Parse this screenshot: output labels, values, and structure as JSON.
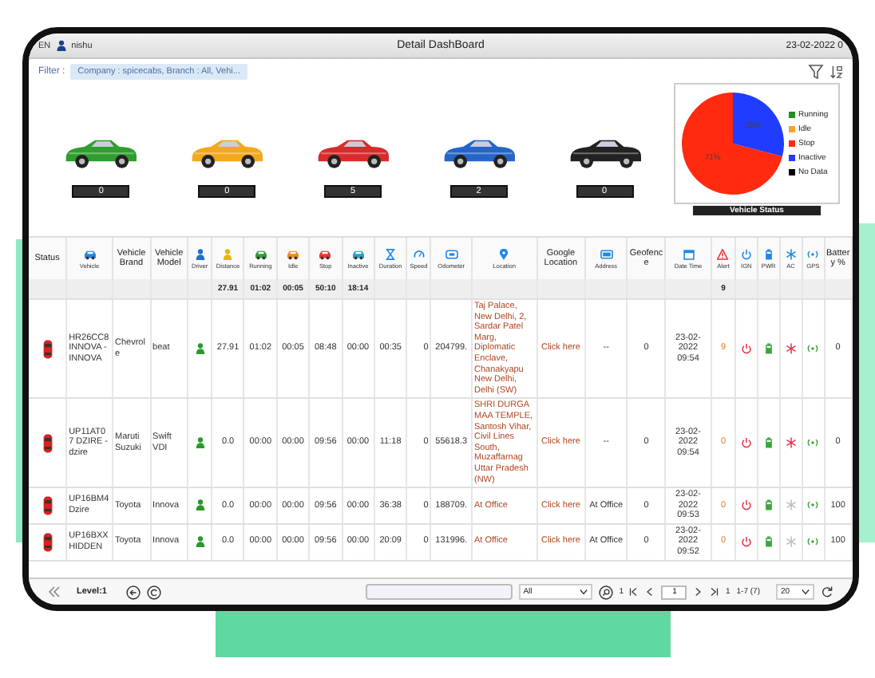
{
  "topbar": {
    "language": "EN",
    "user": "nishu",
    "title": "Detail DashBoard",
    "date": "23-02-2022 0"
  },
  "filter": {
    "label": "Filter :",
    "value": "Company : spicecabs, Branch : All, Vehi..."
  },
  "status_cards": [
    {
      "count": "0",
      "color": "#2f9e2f"
    },
    {
      "count": "0",
      "color": "#f2a81d"
    },
    {
      "count": "5",
      "color": "#d92b2b"
    },
    {
      "count": "2",
      "color": "#2565c8"
    },
    {
      "count": "0",
      "color": "#222222"
    }
  ],
  "status_chart": {
    "title": "Vehicle Status",
    "legend": [
      {
        "color": "#1f8f1f"
      },
      {
        "color": "#f5a623"
      },
      {
        "color": "#ff2a10"
      },
      {
        "color": "#1f3cff"
      },
      {
        "color": "#000000"
      }
    ],
    "chart_data": {
      "type": "pie",
      "categories": [
        "Running",
        "Idle",
        "Stop",
        "Inactive",
        "No Data"
      ],
      "values": [
        0,
        0,
        71,
        29,
        0
      ],
      "value_labels": [
        null,
        null,
        "71%",
        "29%",
        null
      ]
    }
  },
  "table": {
    "columns": [
      {
        "label": "Status",
        "kind": "text"
      },
      {
        "label": "Vehicle",
        "kind": "icon"
      },
      {
        "label": "Vehicle Brand",
        "kind": "text"
      },
      {
        "label": "Vehicle Model",
        "kind": "text"
      },
      {
        "label": "Driver",
        "kind": "icon"
      },
      {
        "label": "Distance",
        "kind": "icon",
        "total": "27.91"
      },
      {
        "label": "Running",
        "kind": "icon",
        "total": "01:02"
      },
      {
        "label": "Idle",
        "kind": "icon",
        "total": "00:05"
      },
      {
        "label": "Stop",
        "kind": "icon",
        "total": "50:10"
      },
      {
        "label": "Inactive",
        "kind": "icon",
        "total": "18:14"
      },
      {
        "label": "Duration",
        "kind": "icon"
      },
      {
        "label": "Speed",
        "kind": "icon"
      },
      {
        "label": "Odometer",
        "kind": "icon"
      },
      {
        "label": "Location",
        "kind": "icon"
      },
      {
        "label": "Google Location",
        "kind": "text"
      },
      {
        "label": "Address",
        "kind": "icon"
      },
      {
        "label": "Geofence",
        "kind": "text"
      },
      {
        "label": "Date Time",
        "kind": "icon"
      },
      {
        "label": "Alert",
        "kind": "icon",
        "total": "9"
      },
      {
        "label": "IGN",
        "kind": "icon"
      },
      {
        "label": "PWR",
        "kind": "icon"
      },
      {
        "label": "AC",
        "kind": "icon"
      },
      {
        "label": "GPS",
        "kind": "icon"
      },
      {
        "label": "Battery %",
        "kind": "text"
      }
    ],
    "rows": [
      {
        "vehicle": "HR26CC8 INNOVA - INNOVA",
        "brand": "Chevrole",
        "model": "beat",
        "distance": "27.91",
        "running": "01:02",
        "idle": "00:05",
        "stop": "08:48",
        "inactive": "00:00",
        "duration": "00:35",
        "speed": "0",
        "odometer": "204799.",
        "location": "Taj Palace, New Delhi, 2, Sardar Patel Marg, Diplomatic Enclave, Chanakyapu New Delhi, Delhi (SW)",
        "google_location": "Click here",
        "address": "--",
        "geofence": "0",
        "date_time": "23-02-2022 09:54",
        "alert": "9",
        "ac_on": true,
        "battery": "0"
      },
      {
        "vehicle": "UP11AT07 DZIRE - dzire",
        "brand": "Maruti Suzuki",
        "model": "Swift VDI",
        "distance": "0.0",
        "running": "00:00",
        "idle": "00:00",
        "stop": "09:56",
        "inactive": "00:00",
        "duration": "11:18",
        "speed": "0",
        "odometer": "55618.3",
        "location": "SHRI DURGA MAA TEMPLE, Santosh Vihar, Civil Lines South, Muzaffarnag Uttar Pradesh (NW)",
        "google_location": "Click here",
        "address": "--",
        "geofence": "0",
        "date_time": "23-02-2022 09:54",
        "alert": "0",
        "ac_on": true,
        "battery": "0"
      },
      {
        "vehicle": "UP16BM4 Dzire",
        "brand": "Toyota",
        "model": "Innova",
        "distance": "0.0",
        "running": "00:00",
        "idle": "00:00",
        "stop": "09:56",
        "inactive": "00:00",
        "duration": "36:38",
        "speed": "0",
        "odometer": "188709.",
        "location": "At Office",
        "google_location": "Click here",
        "address": "At Office",
        "geofence": "0",
        "date_time": "23-02-2022 09:53",
        "alert": "0",
        "ac_on": false,
        "battery": "100"
      },
      {
        "vehicle": "UP16BXX HIDDEN",
        "brand": "Toyota",
        "model": "Innova",
        "distance": "0.0",
        "running": "00:00",
        "idle": "00:00",
        "stop": "09:56",
        "inactive": "00:00",
        "duration": "20:09",
        "speed": "0",
        "odometer": "131996.",
        "location": "At Office",
        "google_location": "Click here",
        "address": "At Office",
        "geofence": "0",
        "date_time": "23-02-2022 09:52",
        "alert": "0",
        "ac_on": false,
        "battery": "100"
      }
    ]
  },
  "footer": {
    "level": "Level:1",
    "view_select": "All",
    "page_label": "1",
    "page": "1",
    "page_count": "1",
    "range": "1-7 (7)",
    "page_size": "20"
  }
}
